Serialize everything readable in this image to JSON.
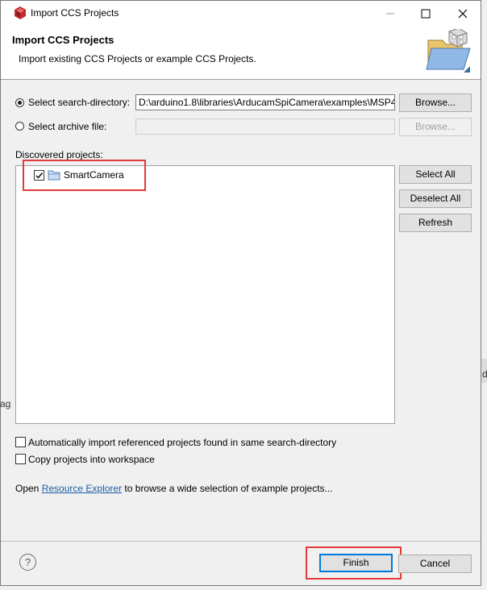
{
  "window": {
    "title": "Import CCS Projects"
  },
  "header": {
    "title": "Import CCS Projects",
    "description": "Import existing CCS Projects or example CCS Projects."
  },
  "source": {
    "search_dir_label": "Select search-directory:",
    "search_dir_value": "D:\\arduino1.8\\libraries\\ArducamSpiCamera\\examples\\MSP4",
    "archive_label": "Select archive file:",
    "archive_value": "",
    "browse_label": "Browse...",
    "browse_archive_label": "Browse...",
    "selected": "search-directory"
  },
  "projects": {
    "label": "Discovered projects:",
    "items": [
      {
        "name": "SmartCamera",
        "checked": true
      }
    ],
    "select_all": "Select All",
    "deselect_all": "Deselect All",
    "refresh": "Refresh"
  },
  "options": {
    "auto_import_label": "Automatically import referenced projects found in same search-directory",
    "auto_import_checked": false,
    "copy_label": "Copy projects into workspace",
    "copy_checked": false
  },
  "info": {
    "prefix": "Open",
    "link": "Resource Explorer",
    "suffix": "to browse a wide selection of example projects..."
  },
  "footer": {
    "finish": "Finish",
    "cancel": "Cancel"
  },
  "background": {
    "right_glyph": "d",
    "left_glyph": "ag"
  },
  "colors": {
    "highlight": "#e23a3a",
    "accent": "#0078d7",
    "link": "#1a5ea8"
  }
}
